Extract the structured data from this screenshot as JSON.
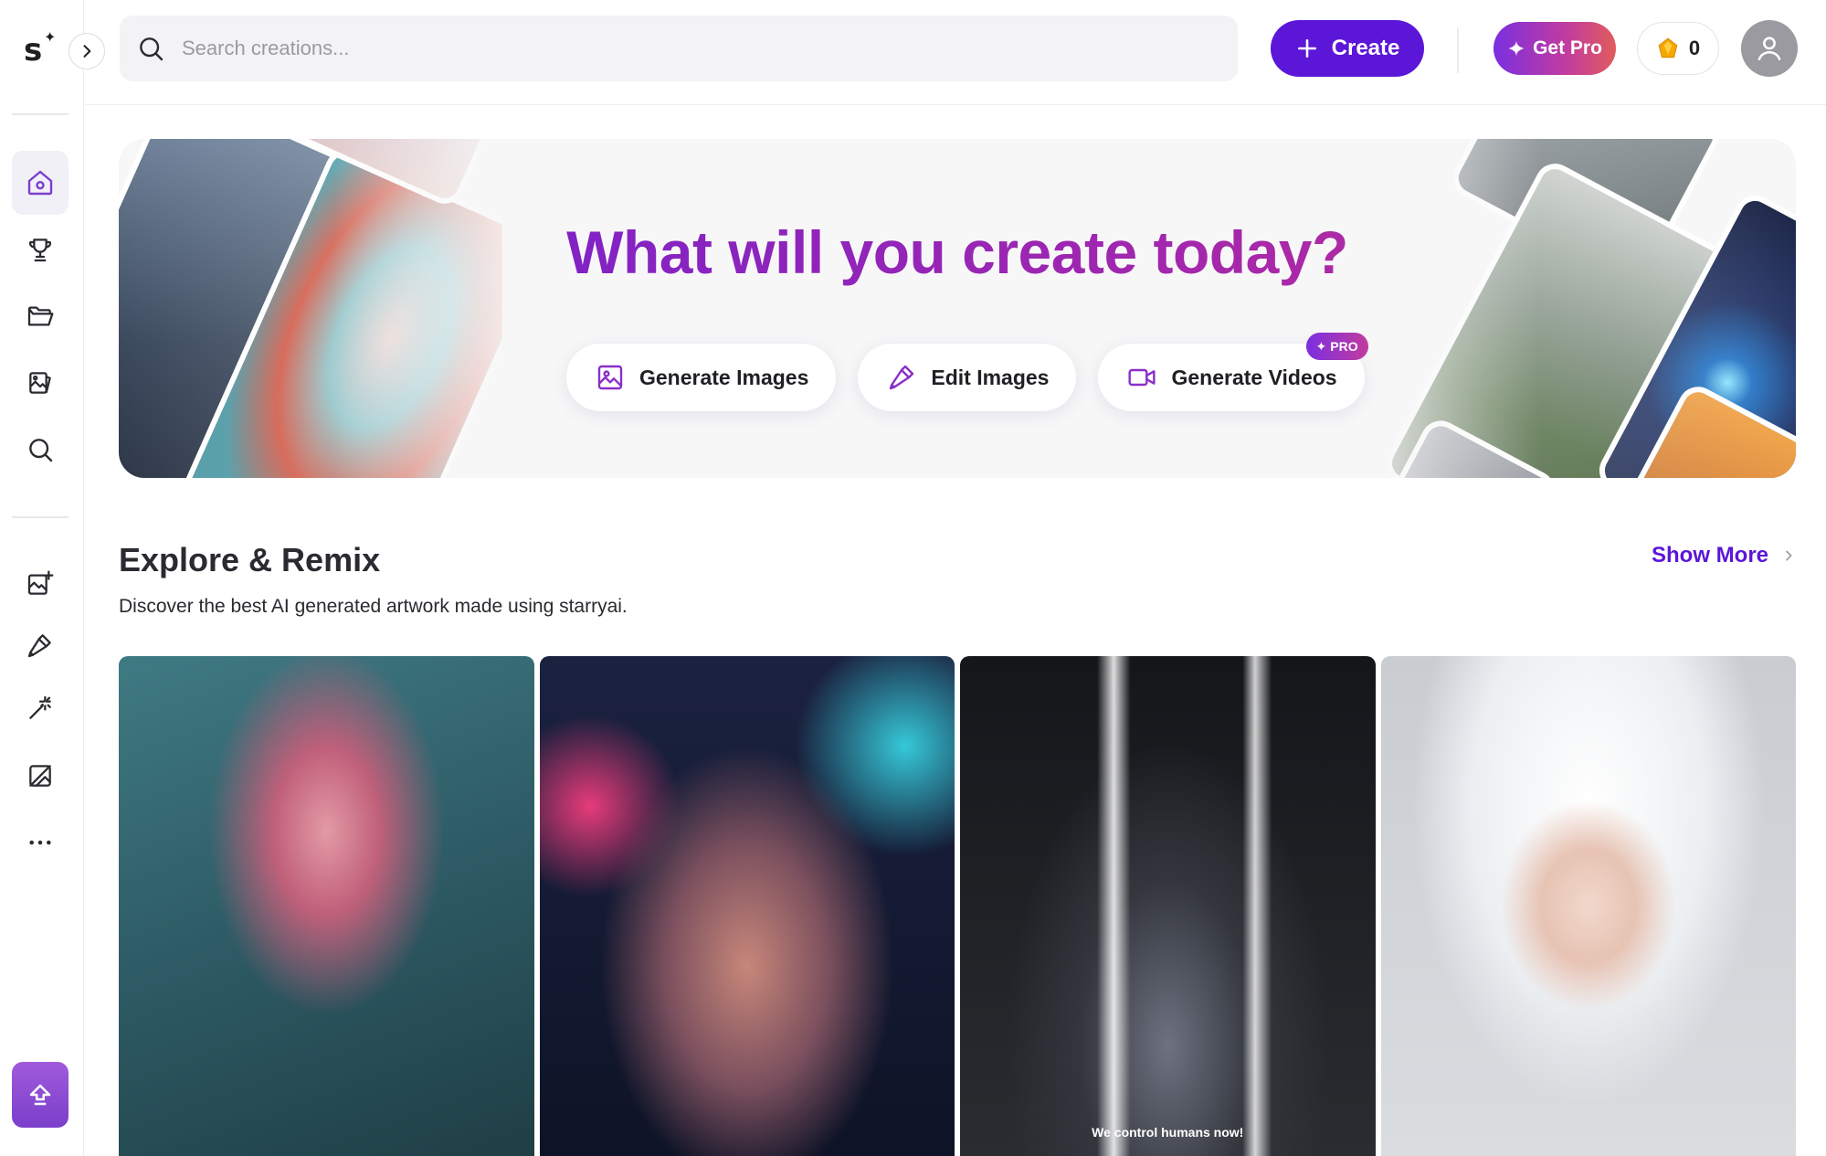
{
  "brand": {
    "logo_text": "s",
    "logo_spark": "✦"
  },
  "sidebar": {
    "toggle_icon": "chevron-right-icon",
    "nav_top": [
      {
        "id": "home",
        "icon": "home-icon",
        "active": true
      },
      {
        "id": "trophy",
        "icon": "trophy-icon",
        "active": false
      },
      {
        "id": "folder",
        "icon": "folder-open-icon",
        "active": false
      },
      {
        "id": "gallery",
        "icon": "image-stack-icon",
        "active": false
      },
      {
        "id": "search",
        "icon": "search-icon",
        "active": false
      }
    ],
    "nav_tools": [
      {
        "id": "generate",
        "icon": "image-plus-icon"
      },
      {
        "id": "edit",
        "icon": "brush-icon"
      },
      {
        "id": "magic",
        "icon": "magic-wand-icon"
      },
      {
        "id": "remove",
        "icon": "image-off-icon"
      },
      {
        "id": "more",
        "icon": "ellipsis-icon"
      }
    ],
    "upgrade_icon": "upgrade-arrow-icon"
  },
  "header": {
    "search_placeholder": "Search creations...",
    "create_label": "Create",
    "get_pro_label": "Get Pro",
    "credits_count": "0"
  },
  "hero": {
    "title": "What will you create today?",
    "actions": [
      {
        "label": "Generate Images",
        "icon": "image-icon"
      },
      {
        "label": "Edit Images",
        "icon": "brush-icon"
      },
      {
        "label": "Generate Videos",
        "icon": "video-icon",
        "badge": "PRO"
      }
    ]
  },
  "explore": {
    "title": "Explore & Remix",
    "subtitle": "Discover the best AI generated artwork made using starryai.",
    "show_more_label": "Show More",
    "cards": [
      {
        "caption": ""
      },
      {
        "caption": ""
      },
      {
        "caption": "We control humans now!"
      },
      {
        "caption": ""
      }
    ]
  },
  "colors": {
    "accent": "#5b16d8",
    "pro_gradient_start": "#7a2fe0",
    "pro_gradient_end": "#c23c9e",
    "sidebar_active_bg": "#f1f0f7",
    "icon_purple": "#7b3fcb"
  }
}
